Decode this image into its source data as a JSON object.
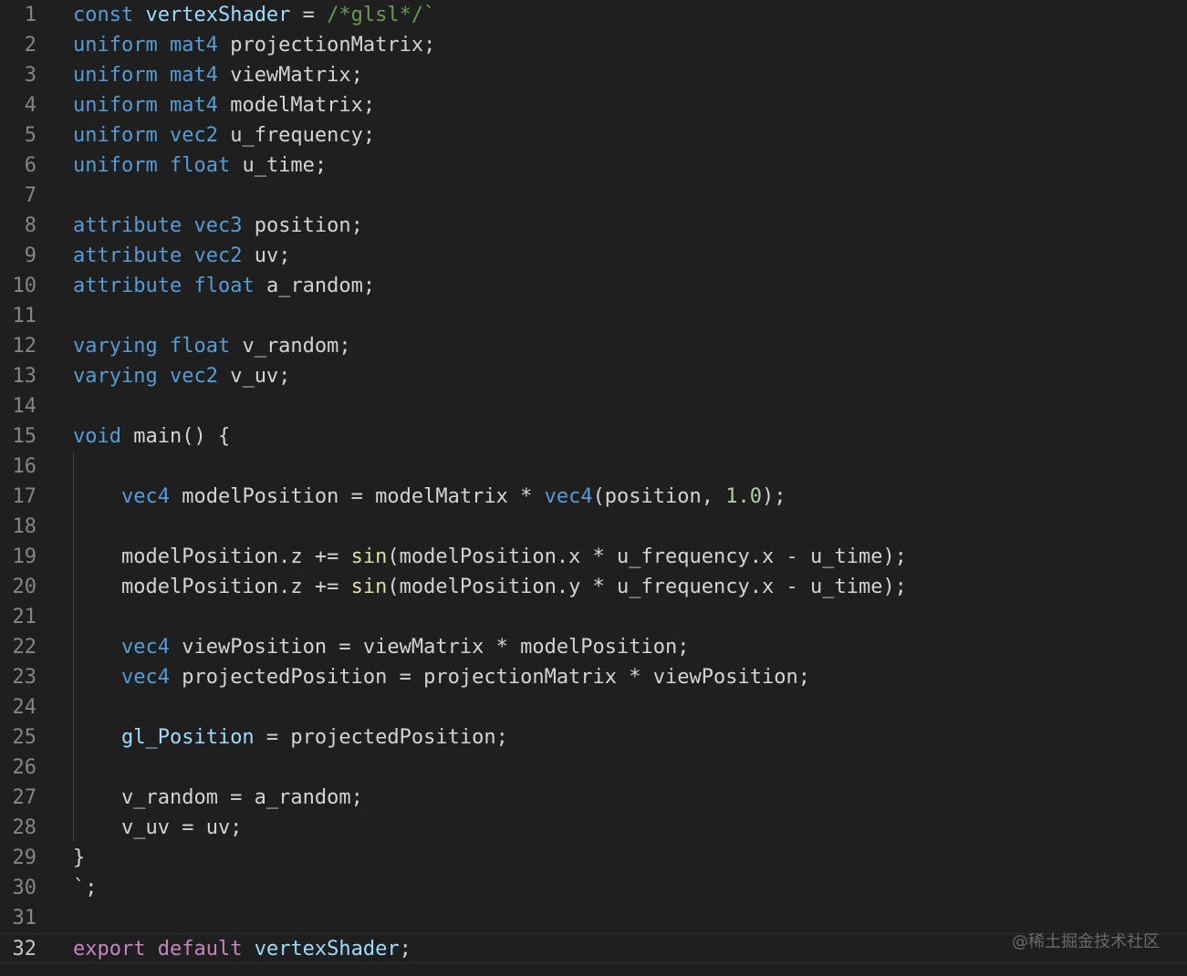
{
  "editor": {
    "active_line": 32,
    "lines": [
      {
        "n": "1",
        "tokens": [
          {
            "t": "const",
            "c": "kw"
          },
          {
            "t": " "
          },
          {
            "t": "vertexShader",
            "c": "var"
          },
          {
            "t": " = "
          },
          {
            "t": "/*glsl*/`",
            "c": "cm"
          }
        ]
      },
      {
        "n": "2",
        "tokens": [
          {
            "t": "uniform",
            "c": "kw"
          },
          {
            "t": " "
          },
          {
            "t": "mat4",
            "c": "kw"
          },
          {
            "t": " projectionMatrix;"
          }
        ]
      },
      {
        "n": "3",
        "tokens": [
          {
            "t": "uniform",
            "c": "kw"
          },
          {
            "t": " "
          },
          {
            "t": "mat4",
            "c": "kw"
          },
          {
            "t": " viewMatrix;"
          }
        ]
      },
      {
        "n": "4",
        "tokens": [
          {
            "t": "uniform",
            "c": "kw"
          },
          {
            "t": " "
          },
          {
            "t": "mat4",
            "c": "kw"
          },
          {
            "t": " modelMatrix;"
          }
        ]
      },
      {
        "n": "5",
        "tokens": [
          {
            "t": "uniform",
            "c": "kw"
          },
          {
            "t": " "
          },
          {
            "t": "vec2",
            "c": "kw"
          },
          {
            "t": " u_frequency;"
          }
        ]
      },
      {
        "n": "6",
        "tokens": [
          {
            "t": "uniform",
            "c": "kw"
          },
          {
            "t": " "
          },
          {
            "t": "float",
            "c": "kw"
          },
          {
            "t": " u_time;"
          }
        ]
      },
      {
        "n": "7",
        "tokens": []
      },
      {
        "n": "8",
        "tokens": [
          {
            "t": "attribute",
            "c": "kw"
          },
          {
            "t": " "
          },
          {
            "t": "vec3",
            "c": "kw"
          },
          {
            "t": " position;"
          }
        ]
      },
      {
        "n": "9",
        "tokens": [
          {
            "t": "attribute",
            "c": "kw"
          },
          {
            "t": " "
          },
          {
            "t": "vec2",
            "c": "kw"
          },
          {
            "t": " uv;"
          }
        ]
      },
      {
        "n": "10",
        "tokens": [
          {
            "t": "attribute",
            "c": "kw"
          },
          {
            "t": " "
          },
          {
            "t": "float",
            "c": "kw"
          },
          {
            "t": " a_random;"
          }
        ]
      },
      {
        "n": "11",
        "tokens": []
      },
      {
        "n": "12",
        "tokens": [
          {
            "t": "varying",
            "c": "kw"
          },
          {
            "t": " "
          },
          {
            "t": "float",
            "c": "kw"
          },
          {
            "t": " v_random;"
          }
        ]
      },
      {
        "n": "13",
        "tokens": [
          {
            "t": "varying",
            "c": "kw"
          },
          {
            "t": " "
          },
          {
            "t": "vec2",
            "c": "kw"
          },
          {
            "t": " v_uv;"
          }
        ]
      },
      {
        "n": "14",
        "tokens": []
      },
      {
        "n": "15",
        "tokens": [
          {
            "t": "void",
            "c": "kw"
          },
          {
            "t": " main() {"
          }
        ]
      },
      {
        "n": "16",
        "tokens": []
      },
      {
        "n": "17",
        "tokens": [
          {
            "t": "    "
          },
          {
            "t": "vec4",
            "c": "kw"
          },
          {
            "t": " modelPosition = modelMatrix * "
          },
          {
            "t": "vec4",
            "c": "kw"
          },
          {
            "t": "(position, "
          },
          {
            "t": "1.0",
            "c": "num"
          },
          {
            "t": ");"
          }
        ]
      },
      {
        "n": "18",
        "tokens": []
      },
      {
        "n": "19",
        "tokens": [
          {
            "t": "    modelPosition.z += "
          },
          {
            "t": "sin",
            "c": "fn"
          },
          {
            "t": "(modelPosition.x * u_frequency.x - u_time);"
          }
        ]
      },
      {
        "n": "20",
        "tokens": [
          {
            "t": "    modelPosition.z += "
          },
          {
            "t": "sin",
            "c": "fn"
          },
          {
            "t": "(modelPosition.y * u_frequency.x - u_time);"
          }
        ]
      },
      {
        "n": "21",
        "tokens": []
      },
      {
        "n": "22",
        "tokens": [
          {
            "t": "    "
          },
          {
            "t": "vec4",
            "c": "kw"
          },
          {
            "t": " viewPosition = viewMatrix * modelPosition;"
          }
        ]
      },
      {
        "n": "23",
        "tokens": [
          {
            "t": "    "
          },
          {
            "t": "vec4",
            "c": "kw"
          },
          {
            "t": " projectedPosition = projectionMatrix * viewPosition;"
          }
        ]
      },
      {
        "n": "24",
        "tokens": []
      },
      {
        "n": "25",
        "tokens": [
          {
            "t": "    "
          },
          {
            "t": "gl_Position",
            "c": "var"
          },
          {
            "t": " = projectedPosition;"
          }
        ]
      },
      {
        "n": "26",
        "tokens": []
      },
      {
        "n": "27",
        "tokens": [
          {
            "t": "    v_random = a_random;"
          }
        ]
      },
      {
        "n": "28",
        "tokens": [
          {
            "t": "    v_uv = uv;"
          }
        ]
      },
      {
        "n": "29",
        "tokens": [
          {
            "t": "}"
          }
        ]
      },
      {
        "n": "30",
        "tokens": [
          {
            "t": "`;"
          }
        ]
      },
      {
        "n": "31",
        "tokens": []
      },
      {
        "n": "32",
        "tokens": [
          {
            "t": "export",
            "c": "ctrl"
          },
          {
            "t": " "
          },
          {
            "t": "default",
            "c": "ctrl"
          },
          {
            "t": " "
          },
          {
            "t": "vertexShader",
            "c": "var"
          },
          {
            "t": ";"
          }
        ]
      }
    ]
  },
  "watermark": "@稀土掘金技术社区",
  "colors": {
    "background": "#1f1f1f",
    "keyword": "#569cd6",
    "control": "#c586c0",
    "function": "#dcdcaa",
    "number": "#b5cea8",
    "comment": "#6a9955",
    "variable": "#9cdcfe",
    "plain": "#d4d4d4",
    "line_number": "#858585"
  }
}
